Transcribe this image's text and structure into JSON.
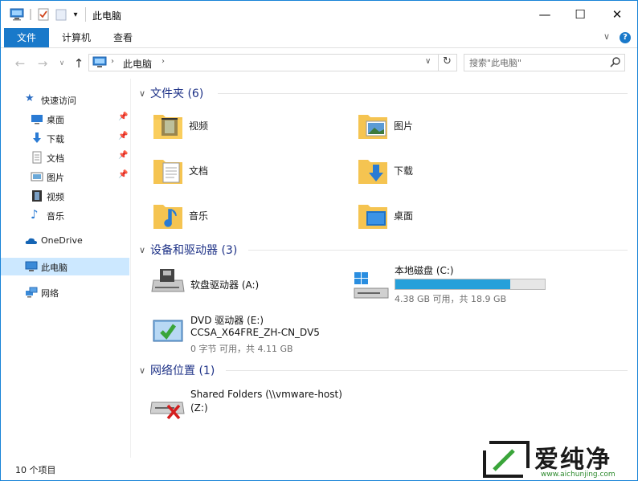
{
  "window": {
    "title": "此电脑"
  },
  "titlebar": {
    "minimize": "—",
    "maximize": "☐",
    "close": "✕"
  },
  "ribbon": {
    "tabs": [
      "文件",
      "计算机",
      "查看"
    ],
    "help": "?"
  },
  "address": {
    "crumb": "此电脑",
    "search_placeholder": "搜索\"此电脑\""
  },
  "nav": {
    "quick_access": "快速访问",
    "quick_items": [
      "桌面",
      "下载",
      "文档",
      "图片",
      "视频",
      "音乐"
    ],
    "onedrive": "OneDrive",
    "this_pc": "此电脑",
    "network": "网络"
  },
  "groups": {
    "folders": {
      "title": "文件夹 (6)",
      "items": [
        "视频",
        "图片",
        "文档",
        "下载",
        "音乐",
        "桌面"
      ]
    },
    "devices": {
      "title": "设备和驱动器 (3)",
      "floppy": "软盘驱动器 (A:)",
      "local": {
        "name": "本地磁盘 (C:)",
        "detail": "4.38 GB 可用，共 18.9 GB",
        "used_fraction": 0.77
      },
      "dvd": {
        "name": "DVD 驱动器 (E:)",
        "label": "CCSA_X64FRE_ZH-CN_DV5",
        "detail": "0 字节 可用，共 4.11 GB"
      }
    },
    "network": {
      "title": "网络位置 (1)",
      "share_name": "Shared Folders (\\\\vmware-host)",
      "share_drive": "(Z:)"
    }
  },
  "status": {
    "count": "10 个项目"
  },
  "watermark": {
    "brand": "爱纯净",
    "url": "www.aichunjing.com"
  },
  "colors": {
    "accent": "#1979ca",
    "selected": "#cce8ff",
    "bar": "#26a0da",
    "group_title": "#1e3287"
  }
}
